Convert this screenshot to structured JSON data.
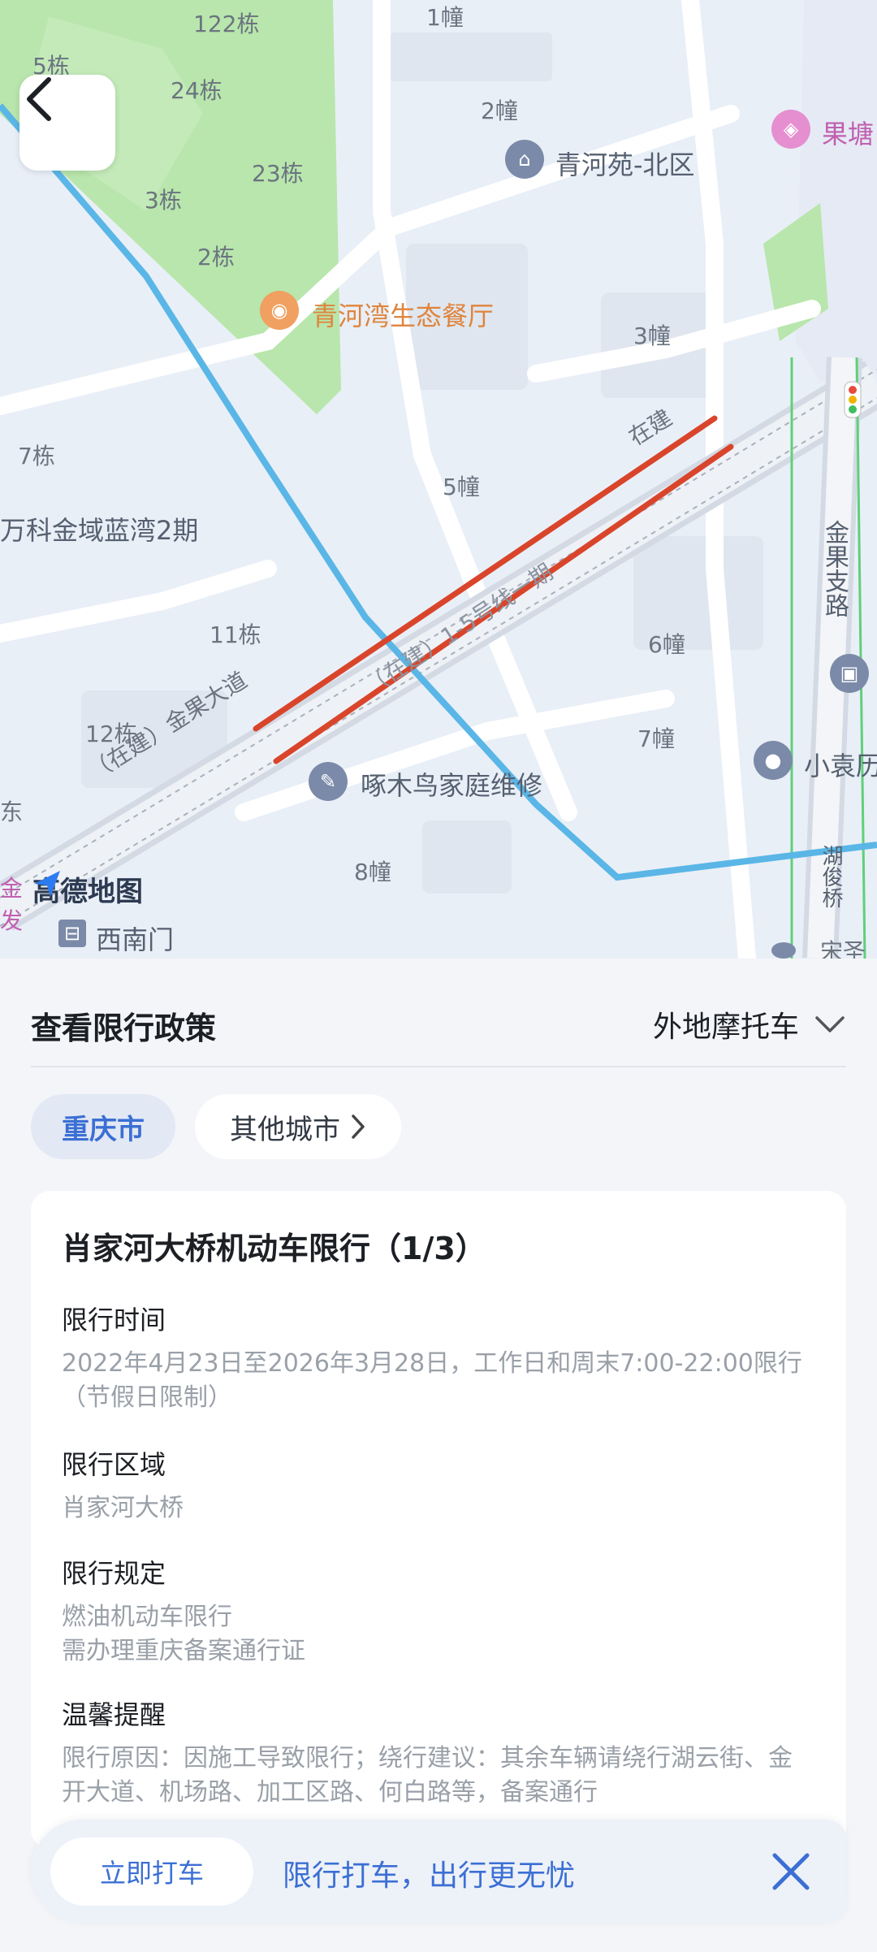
{
  "map": {
    "labels": {
      "b1": "1幢",
      "b122": "122栋",
      "b5": "5栋",
      "b24": "24栋",
      "b23": "23栋",
      "b3": "3栋",
      "b2": "2栋",
      "b2z": "2幢",
      "b3z": "3幢",
      "b7": "7栋",
      "b5z": "5幢",
      "b11": "11栋",
      "b12": "12栋",
      "b6z": "6幢",
      "b7z": "7幢",
      "b8z": "8幢",
      "qinghe": "青河苑-北区",
      "canting": "青河湾生态餐厅",
      "lanwan": "万科金域蓝湾2期",
      "zaijian": "在建",
      "jinguo_road": "（在建）金果大道",
      "line15": "（在建）1-5号线一期",
      "jinguo_branch": "金果支路",
      "repair": "啄木鸟家庭维修",
      "xiaoyuan": "小袁历",
      "xinanmen": "西南门",
      "hujunqiao": "湖俊桥",
      "guotang": "果塘",
      "jin": "金",
      "fa": "发",
      "song": "宋圣",
      "dong": "东"
    },
    "logo": "高德地图",
    "colors": {
      "restriction": "#d9452b",
      "water": "#5ab6e6",
      "green": "#aee3a4",
      "orange": "#e0843c"
    }
  },
  "panel": {
    "title": "查看限行政策",
    "vehicle": "外地摩托车",
    "city_active": "重庆市",
    "city_other": "其他城市"
  },
  "card": {
    "title": "肖家河大桥机动车限行（1/3）",
    "time_title": "限行时间",
    "time_text": "2022年4月23日至2026年3月28日，工作日和周末7:00-22:00限行（节假日限制）",
    "area_title": "限行区域",
    "area_text": "肖家河大桥",
    "rule_title": "限行规定",
    "rule_line1": "燃油机动车限行",
    "rule_line2": "需办理重庆备案通行证",
    "tip_title": "温馨提醒",
    "tip_text": "限行原因：因施工导致限行；绕行建议：其余车辆请绕行湖云街、金开大道、机场路、加工区路、何白路等，备案通行"
  },
  "bottom_bar": {
    "button": "立即打车",
    "slogan": "限行打车，出行更无忧"
  }
}
